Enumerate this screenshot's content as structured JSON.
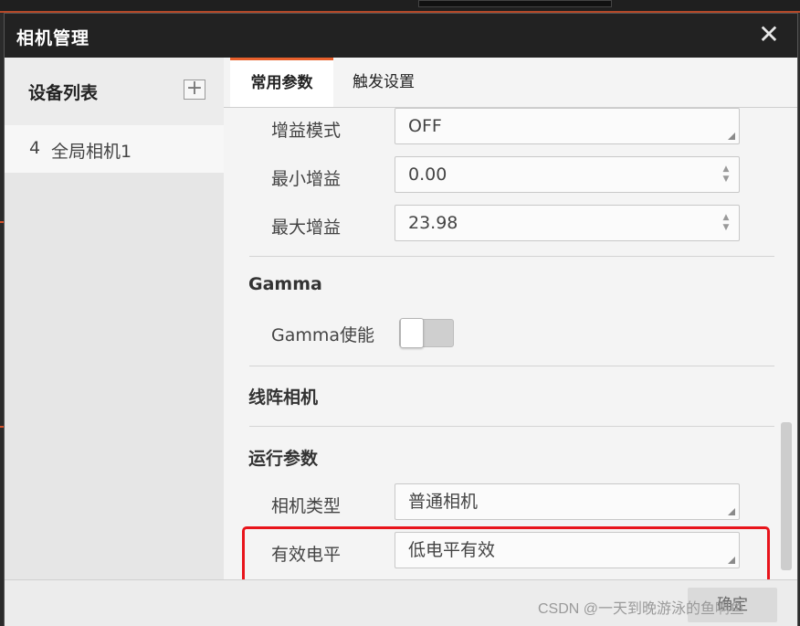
{
  "dialog": {
    "title": "相机管理",
    "close_label": "✕"
  },
  "sidebar": {
    "title": "设备列表",
    "add_label": "+",
    "devices": [
      {
        "index": "4",
        "name": "全局相机1"
      }
    ]
  },
  "tabs": [
    {
      "label": "常用参数",
      "active": true
    },
    {
      "label": "触发设置",
      "active": false
    }
  ],
  "gain": {
    "mode_label": "增益模式",
    "mode_value": "OFF",
    "min_label": "最小增益",
    "min_value": "0.00",
    "max_label": "最大增益",
    "max_value": "23.98"
  },
  "gamma": {
    "section_title": "Gamma",
    "enable_label": "Gamma使能",
    "enabled": false
  },
  "line_camera": {
    "section_title": "线阵相机"
  },
  "runtime": {
    "section_title": "运行参数",
    "camera_type_label": "相机类型",
    "camera_type_value": "普通相机",
    "active_level_label": "有效电平",
    "active_level_value": "低电平有效"
  },
  "footer": {
    "ok_label": "确定"
  },
  "watermark": "CSDN @一天到晚游泳的鱼啊鱼",
  "colors": {
    "accent": "#e8602c",
    "highlight": "#e8141b",
    "titlebar": "#222222"
  }
}
